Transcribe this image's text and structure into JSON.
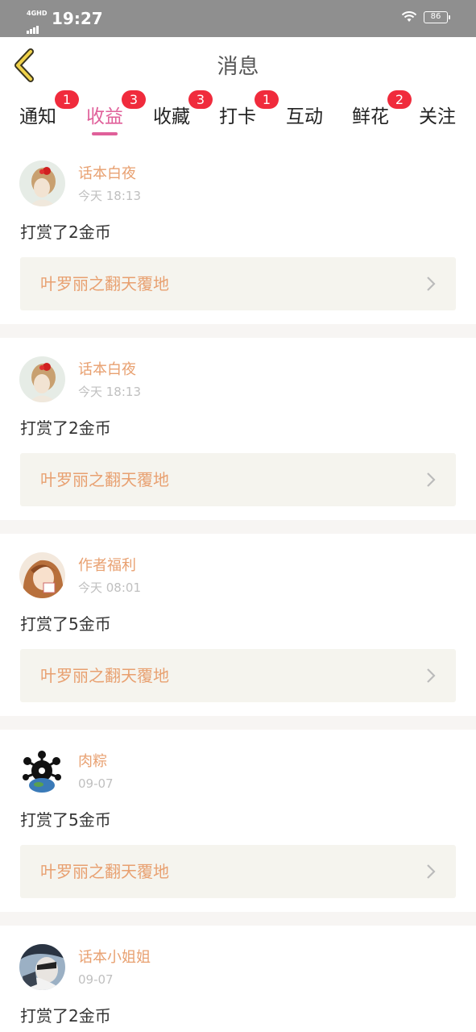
{
  "status_bar": {
    "network": "4GHD",
    "time": "19:27",
    "battery": "86"
  },
  "header": {
    "title": "消息",
    "back_icon": "chevron-left-icon"
  },
  "colors": {
    "accent": "#e0609a",
    "badge": "#f02b3c",
    "name": "#e8a070",
    "status_bar": "#8f8f8f",
    "link_bg": "#f5f4ee"
  },
  "tabs": [
    {
      "label": "通知",
      "badge": "1",
      "active": false
    },
    {
      "label": "收益",
      "badge": "3",
      "active": true
    },
    {
      "label": "收藏",
      "badge": "3",
      "active": false
    },
    {
      "label": "打卡",
      "badge": "1",
      "active": false
    },
    {
      "label": "互动",
      "badge": "",
      "active": false
    },
    {
      "label": "鲜花",
      "badge": "2",
      "active": false
    },
    {
      "label": "关注",
      "badge": "",
      "active": false
    }
  ],
  "messages": [
    {
      "name": "话本白夜",
      "time": "今天 18:13",
      "text": "打赏了2金币",
      "book": "叶罗丽之翻天覆地"
    },
    {
      "name": "话本白夜",
      "time": "今天 18:13",
      "text": "打赏了2金币",
      "book": "叶罗丽之翻天覆地"
    },
    {
      "name": "作者福利",
      "time": "今天 08:01",
      "text": "打赏了5金币",
      "book": "叶罗丽之翻天覆地"
    },
    {
      "name": "肉粽",
      "time": "09-07",
      "text": "打赏了5金币",
      "book": "叶罗丽之翻天覆地"
    },
    {
      "name": "话本小姐姐",
      "time": "09-07",
      "text": "打赏了2金币",
      "book": ""
    }
  ]
}
